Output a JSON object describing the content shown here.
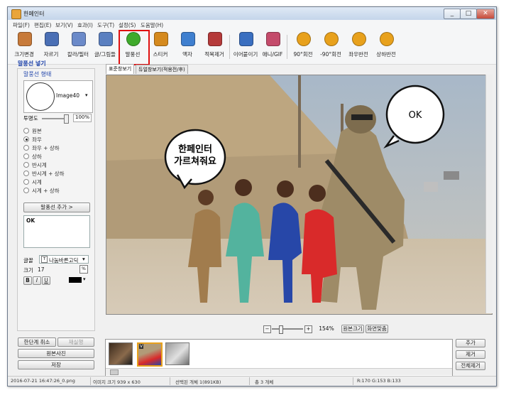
{
  "window": {
    "title": "한페인터",
    "minimize": "_",
    "maximize": "□",
    "close": "✕"
  },
  "menu": [
    "파일(F)",
    "편집(E)",
    "보기(V)",
    "효과(I)",
    "도구(T)",
    "설정(S)",
    "도움말(H)"
  ],
  "toolbar": [
    {
      "label": "크기변경",
      "icon": "resize-icon",
      "color": "#c77a3a"
    },
    {
      "label": "자르기",
      "icon": "crop-icon",
      "color": "#4a6fb5"
    },
    {
      "label": "칼라/필터",
      "icon": "color-filter-icon",
      "color": "#6b8ac9"
    },
    {
      "label": "글/그림들",
      "icon": "text-image-icon",
      "color": "#5a7fc0"
    },
    {
      "label": "말풍선",
      "icon": "speech-bubble-icon",
      "color": "#3faa2b"
    },
    {
      "label": "스티커",
      "icon": "sticker-icon",
      "color": "#d58a1e"
    },
    {
      "label": "액자",
      "icon": "frame-icon",
      "color": "#3f7fcf"
    },
    {
      "label": "적목제거",
      "icon": "red-eye-icon",
      "color": "#b53a3a"
    },
    {
      "label": "이어붙이기",
      "icon": "merge-icon",
      "color": "#3a6fc0"
    },
    {
      "label": "애니/GIF",
      "icon": "gif-icon",
      "color": "#c44b6b"
    },
    {
      "label": "90°회전",
      "icon": "rotate-90-icon",
      "color": "#e8a11c"
    },
    {
      "label": "-90°회전",
      "icon": "rotate-minus-90-icon",
      "color": "#e8a11c"
    },
    {
      "label": "좌우반전",
      "icon": "flip-horizontal-icon",
      "color": "#e8a11c"
    },
    {
      "label": "상하반전",
      "icon": "flip-vertical-icon",
      "color": "#e8a11c"
    }
  ],
  "left_panel": {
    "section_title": "말풍선 넣기",
    "shape_title": "말풍선 형태",
    "shape_name": "Image40",
    "opacity_label": "투명도",
    "opacity_value": "100%",
    "opacity_fraction": 1.0,
    "orientation_options": [
      {
        "label": "원본",
        "selected": false
      },
      {
        "label": "좌우",
        "selected": true
      },
      {
        "label": "좌우 + 상하",
        "selected": false
      },
      {
        "label": "상하",
        "selected": false
      },
      {
        "label": "반시계",
        "selected": false
      },
      {
        "label": "반시계 + 상하",
        "selected": false
      },
      {
        "label": "시계",
        "selected": false
      },
      {
        "label": "시계 + 상하",
        "selected": false
      }
    ],
    "add_bubble_button": "말풍선 추가 >",
    "bubble_text": "OK",
    "font_label": "글꼴",
    "font_value": "나눔바른고딕",
    "size_label": "크기",
    "size_value": "17",
    "bold": "B",
    "italic": "I",
    "underline": "U",
    "text_color": "#000000"
  },
  "tabs": [
    "표준창보기",
    "듀얼창보기(적용전/후)"
  ],
  "canvas": {
    "bubble_left_line1": "한페인터",
    "bubble_left_line2": "가르쳐줘요",
    "bubble_right": "OK"
  },
  "zoom": {
    "value": "154%",
    "fit_button": "원본크기",
    "screen_button": "화면맞춤",
    "minus": "−",
    "plus": "+"
  },
  "bottom_left": {
    "undo": "한단계 취소",
    "redo": "재실행",
    "original": "원본사진",
    "save": "저장"
  },
  "bottom_right": {
    "add": "추가",
    "remove": "제거",
    "remove_all": "전체제거"
  },
  "thumbnails": [
    {
      "name": "portrait-thumbnail",
      "badge": ""
    },
    {
      "name": "soldier-kids-thumbnail",
      "badge": "V"
    },
    {
      "name": "koala-thumbnail",
      "badge": ""
    }
  ],
  "status": {
    "file": "2016-07-21 16:47:26_0.png",
    "size": "이미지 크기 939 x 630",
    "selected": "선택된 개체 1(891KB)",
    "total": "총 3 개체",
    "rgb": "R:170 G:153 B:133"
  }
}
